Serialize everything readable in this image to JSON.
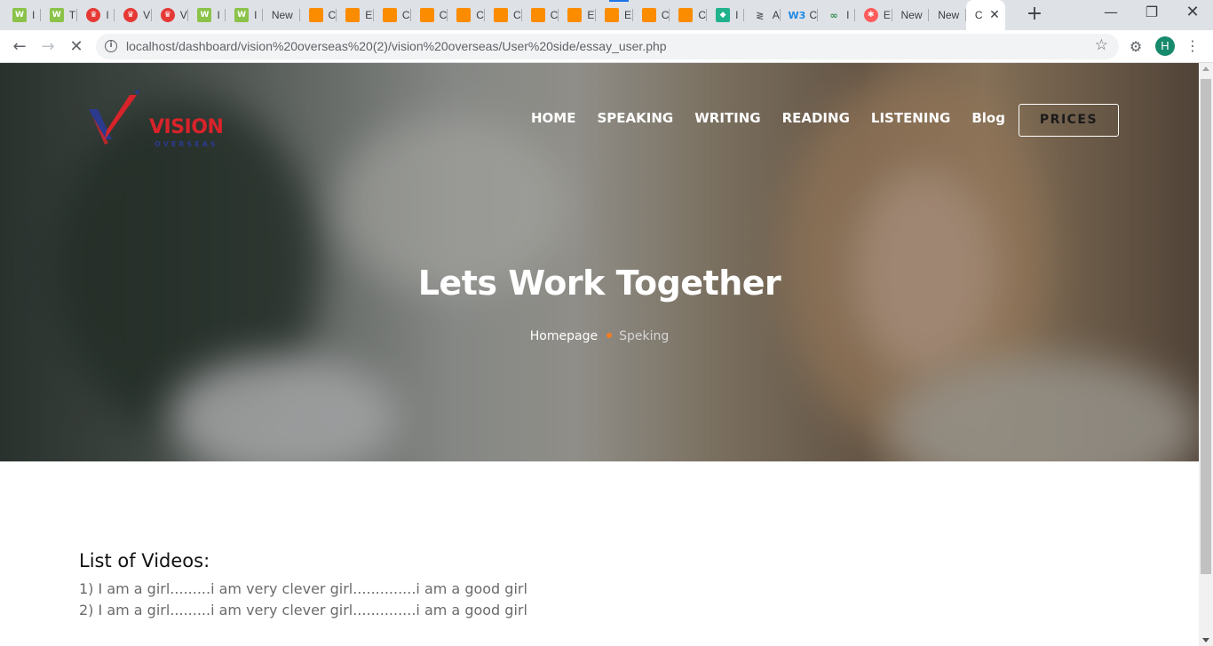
{
  "browser": {
    "tabs": [
      {
        "title": "I",
        "icon": "grammarly-green",
        "color": "#8bc34a",
        "glyph": "W"
      },
      {
        "title": "T",
        "icon": "grammarly-green",
        "color": "#8bc34a",
        "glyph": "W"
      },
      {
        "title": "I",
        "icon": "crown-red",
        "color": "#e53935",
        "glyph": "♛"
      },
      {
        "title": "V",
        "icon": "crown-red",
        "color": "#e53935",
        "glyph": "♛"
      },
      {
        "title": "V",
        "icon": "crown-red",
        "color": "#e53935",
        "glyph": "♛"
      },
      {
        "title": "I",
        "icon": "grammarly-green",
        "color": "#8bc34a",
        "glyph": "W"
      },
      {
        "title": "I",
        "icon": "grammarly-green",
        "color": "#8bc34a",
        "glyph": "W"
      },
      {
        "title": "New",
        "icon": "none",
        "color": "",
        "glyph": ""
      },
      {
        "title": "C",
        "icon": "orange-square",
        "color": "#fb8c00",
        "glyph": ""
      },
      {
        "title": "E",
        "icon": "orange-square",
        "color": "#fb8c00",
        "glyph": ""
      },
      {
        "title": "C",
        "icon": "orange-square",
        "color": "#fb8c00",
        "glyph": ""
      },
      {
        "title": "C",
        "icon": "orange-square",
        "color": "#fb8c00",
        "glyph": ""
      },
      {
        "title": "C",
        "icon": "orange-square",
        "color": "#fb8c00",
        "glyph": ""
      },
      {
        "title": "C",
        "icon": "orange-square",
        "color": "#fb8c00",
        "glyph": ""
      },
      {
        "title": "C",
        "icon": "orange-square",
        "color": "#fb8c00",
        "glyph": ""
      },
      {
        "title": "E",
        "icon": "orange-square",
        "color": "#fb8c00",
        "glyph": ""
      },
      {
        "title": "E",
        "icon": "orange-square",
        "color": "#fb8c00",
        "glyph": ""
      },
      {
        "title": "C",
        "icon": "orange-square",
        "color": "#fb8c00",
        "glyph": ""
      },
      {
        "title": "C",
        "icon": "orange-square",
        "color": "#fb8c00",
        "glyph": ""
      },
      {
        "title": "I",
        "icon": "shield-teal",
        "color": "#20b28c",
        "glyph": "◆"
      },
      {
        "title": "A",
        "icon": "arrows-gray",
        "color": "#5f6368",
        "glyph": "≷"
      },
      {
        "title": "C",
        "icon": "w3-blue",
        "color": "#1e88e5",
        "glyph": "W3"
      },
      {
        "title": "I",
        "icon": "gfg-green",
        "color": "#2f8d46",
        "glyph": "∞"
      },
      {
        "title": "E",
        "icon": "asterisk-pink",
        "color": "#ff5c5c",
        "glyph": "✱"
      },
      {
        "title": "New",
        "icon": "none",
        "color": "",
        "glyph": ""
      },
      {
        "title": "New",
        "icon": "none",
        "color": "",
        "glyph": ""
      }
    ],
    "active_tab_title": "C",
    "url": "localhost/dashboard/vision%20overseas%20(2)/vision%20overseas/User%20side/essay_user.php",
    "profile_initial": "H"
  },
  "site": {
    "logo_text": "VISION",
    "logo_sub": "OVERSEAS",
    "nav": [
      "HOME",
      "SPEAKING",
      "WRITING",
      "READING",
      "LISTENING",
      "Blog"
    ],
    "prices_label": "PRICES",
    "accent": "#f47c20"
  },
  "hero": {
    "title": "Lets Work Together",
    "breadcrumb_home": "Homepage",
    "breadcrumb_current": "Speking"
  },
  "content": {
    "heading": "List of Videos:",
    "videos": [
      "1) I am a girl.........i am very clever girl..............i am a good girl",
      "2) I am a girl.........i am very clever girl..............i am a good girl"
    ]
  }
}
